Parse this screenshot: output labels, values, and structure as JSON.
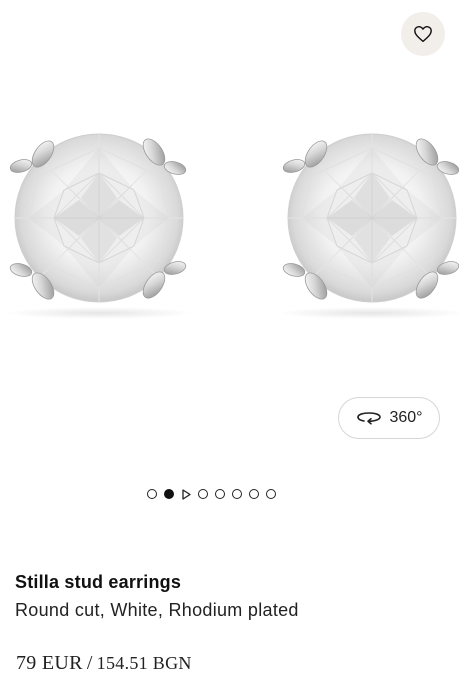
{
  "product": {
    "name": "Stilla stud earrings",
    "variant": "Round cut, White, Rhodium plated",
    "price_primary": "79 EUR",
    "price_separator": "/",
    "price_secondary": "154.51 BGN"
  },
  "gallery": {
    "view_360_label": "360°",
    "slides": [
      {
        "kind": "image",
        "active": false
      },
      {
        "kind": "image",
        "active": true
      },
      {
        "kind": "video",
        "active": false
      },
      {
        "kind": "image",
        "active": false
      },
      {
        "kind": "image",
        "active": false
      },
      {
        "kind": "image",
        "active": false
      },
      {
        "kind": "image",
        "active": false
      },
      {
        "kind": "image",
        "active": false
      }
    ]
  },
  "icons": {
    "wishlist": "heart-icon",
    "view_360": "rotate-360-icon",
    "video_slide": "play-icon"
  },
  "colors": {
    "wishlist_bg": "#f2eeea",
    "text": "#111111"
  }
}
